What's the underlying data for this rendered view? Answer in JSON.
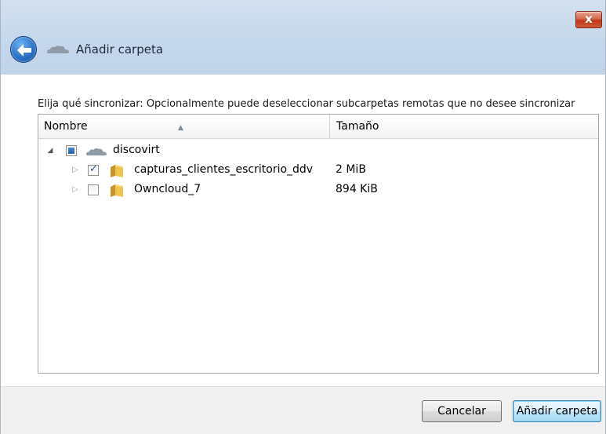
{
  "window": {
    "title": "Añadir carpeta",
    "close_label": "x"
  },
  "instruction": "Elija qué sincronizar: Opcionalmente puede deseleccionar subcarpetas remotas que no desee sincronizar",
  "tree": {
    "columns": {
      "name": "Nombre",
      "size": "Tamaño"
    },
    "root": {
      "label": "discovirt",
      "expanded": true,
      "check_state": "partial"
    },
    "children": [
      {
        "label": "capturas_clientes_escritorio_ddv",
        "size": "2 MiB",
        "checked": true
      },
      {
        "label": "Owncloud_7",
        "size": "894 KiB",
        "checked": false
      }
    ]
  },
  "buttons": {
    "cancel": "Cancelar",
    "add": "Añadir carpeta"
  },
  "colors": {
    "titlebar": "#c6d8ec",
    "close": "#c1371a",
    "folder": "#e8b73a",
    "accent_button_border": "#3c7fb1"
  }
}
